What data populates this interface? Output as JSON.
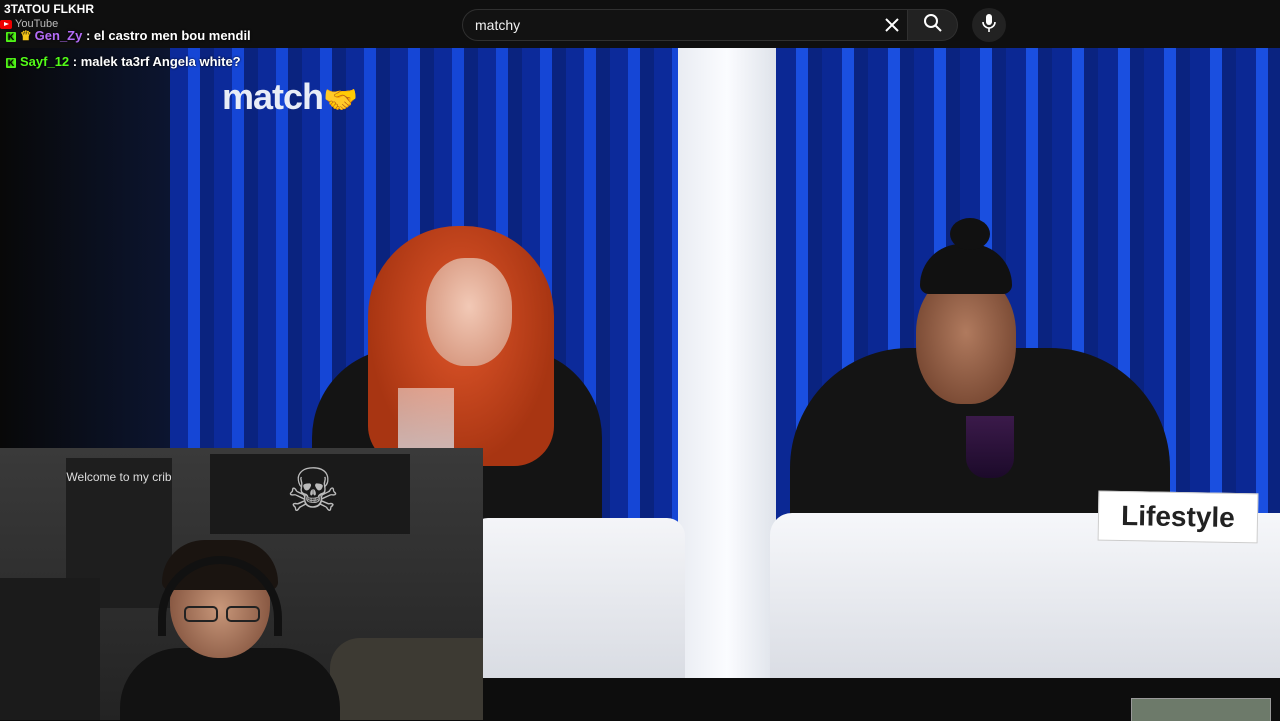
{
  "search": {
    "query": "matchy"
  },
  "icons": {
    "clear": "close-icon",
    "search": "search-icon",
    "mic": "microphone-icon",
    "kick_badge": "kick-icon",
    "crown_badge": "crown-icon",
    "youtube": "youtube-icon"
  },
  "chat": {
    "header": "3TATOU FLKHR",
    "source_label": "YouTube",
    "messages": [
      {
        "user": "Gen_Zy",
        "sep": " : ",
        "text": "el castro men bou mendil",
        "user_color": "#b46cf7"
      },
      {
        "user": "Sayf_12",
        "sep": " : ",
        "text": "malek ta3rf Angela white?",
        "user_color": "#53fc18"
      }
    ]
  },
  "video": {
    "logo_text": "match",
    "nameplate": "Lifestyle"
  },
  "webcam": {
    "poster_text": "Welcome to my crib"
  },
  "colors": {
    "curtain_blue": "#1546d6",
    "kick_green": "#53fc18",
    "background": "#0f0f0f"
  }
}
